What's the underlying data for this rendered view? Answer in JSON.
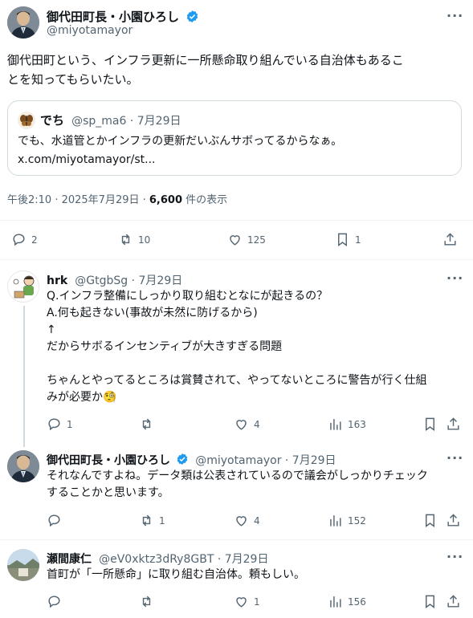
{
  "main_post": {
    "author_name": "御代田町長・小園ひろし",
    "handle": "@miyotamayor",
    "text": "御代田町という、インフラ更新に一所懸命取り組んでいる自治体もあるこ\nとを知ってもらいたい。",
    "quote": {
      "author_name": "でち",
      "handle_date": "@sp_ma6 · 7月29日",
      "text": "でも、水道管とかインフラの更新だいぶんサボってるからなぁ。",
      "link": "x.com/miyotamayor/st..."
    },
    "timestamp": "午後2:10 · 2025年7月29日 · ",
    "views_count": "6,600",
    "views_label": " 件の表示",
    "actions": {
      "replies": "2",
      "reposts": "10",
      "likes": "125",
      "bookmarks": "1"
    }
  },
  "replies": [
    {
      "author_name": "hrk",
      "handle_date": "@GtgbSg · 7月29日",
      "text": "Q.インフラ整備にしっかり取り組むとなにが起きるの？\nA.何も起きない(事故が未然に防げるから)\n↑\nだからサボるインセンティブが大きすぎる問題\n\nちゃんとやってるところは賞賛されて、やってないところに警告が行く仕組\nみが必要か🧐",
      "actions": {
        "replies": "1",
        "reposts": "",
        "likes": "4",
        "views": "163"
      }
    },
    {
      "author_name": "御代田町長・小園ひろし",
      "handle_date": "@miyotamayor · 7月29日",
      "text": "それなんですよね。データ類は公表されているので議会がしっかりチェック\nすることかと思います。",
      "actions": {
        "replies": "",
        "reposts": "1",
        "likes": "4",
        "views": "152"
      }
    },
    {
      "author_name": "瀬間康仁",
      "handle_date": "@eV0xktz3dRy8GBT · 7月29日",
      "text": "首町が「一所懸命」に取り組む自治体。頼もしい。",
      "actions": {
        "replies": "",
        "reposts": "",
        "likes": "1",
        "views": "156"
      }
    }
  ],
  "colors": {
    "accent": "#1d9bf0",
    "muted": "#536471",
    "text": "#0f1419",
    "divider": "#eff3f4"
  }
}
